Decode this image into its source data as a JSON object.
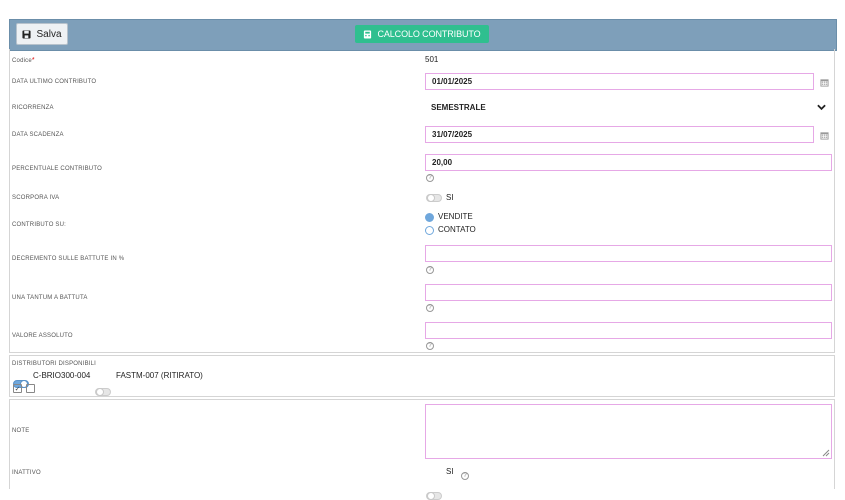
{
  "toolbar": {
    "save_label": "Salva",
    "calc_label": "CALCOLO CONTRIBUTO"
  },
  "form": {
    "codice": {
      "label": "Codice",
      "required_mark": "*",
      "value": "501"
    },
    "data_ultimo": {
      "label": "DATA ULTIMO CONTRIBUTO",
      "value": "01/01/2025"
    },
    "ricorrenza": {
      "label": "RICORRENZA",
      "value": "SEMESTRALE"
    },
    "data_scadenza": {
      "label": "DATA SCADENZA",
      "value": "31/07/2025"
    },
    "percentuale": {
      "label": "PERCENTUALE CONTRIBUTO",
      "value": "20,00"
    },
    "scorpora_iva": {
      "label": "SCORPORA IVA",
      "toggle_label": "SI",
      "checked": false
    },
    "contributo_su": {
      "label": "CONTRIBUTO SU:",
      "options": [
        {
          "label": "VENDITE",
          "selected": true
        },
        {
          "label": "CONTATO",
          "selected": false
        }
      ]
    },
    "decremento": {
      "label": "DECREMENTO SULLE BATTUTE IN %",
      "value": ""
    },
    "una_tantum": {
      "label": "UNA TANTUM A BATTUTA",
      "value": ""
    },
    "valore_assoluto": {
      "label": "VALORE ASSOLUTO",
      "value": ""
    },
    "distributori": {
      "label": "DISTRIBUTORI DISPONIBILI",
      "items": [
        {
          "label": "C-BRIO300-004",
          "checked": true
        },
        {
          "label": "FASTM-007 (RITIRATO)",
          "checked": false
        }
      ],
      "check_mark": "✓"
    },
    "note": {
      "label": "NOTE",
      "value": ""
    },
    "inattivo": {
      "label": "INATTIVO",
      "toggle_label": "SI",
      "checked": false
    }
  },
  "help_glyph": "?",
  "colors": {
    "toolbar": "#7e9fba",
    "accent": "#2fbf8f",
    "field_border": "#e6a8e6",
    "radio": "#6fa7dc"
  }
}
